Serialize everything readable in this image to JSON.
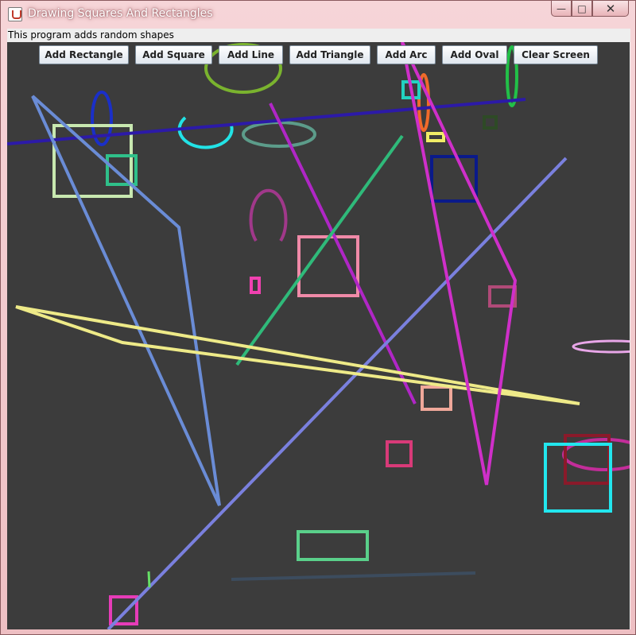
{
  "window": {
    "title": "Drawing Squares And Rectangles"
  },
  "info_text": "This program adds random shapes",
  "toolbar": {
    "buttons": [
      {
        "label": "Add Rectangle"
      },
      {
        "label": "Add Square"
      },
      {
        "label": "Add Line"
      },
      {
        "label": "Add Triangle"
      },
      {
        "label": "Add Arc"
      },
      {
        "label": "Add Oval"
      },
      {
        "label": "Clear Screen"
      }
    ]
  },
  "colors": {
    "canvas_background": "#3c3c3c",
    "shape_colors": [
      "#88a0e6",
      "#f0ec88",
      "#2c1aa8",
      "#c832d6",
      "#2fba7a",
      "#cf2fc9",
      "#22e3e6",
      "#f087a0",
      "#4650c8"
    ]
  }
}
